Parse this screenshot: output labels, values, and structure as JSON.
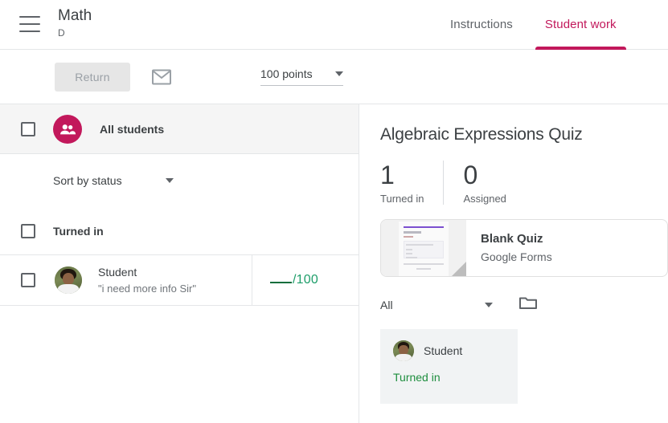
{
  "header": {
    "menu_icon": "hamburger-menu-icon",
    "course_title": "Math",
    "course_section": "D",
    "tabs": [
      {
        "label": "Instructions",
        "active": false
      },
      {
        "label": "Student work",
        "active": true
      }
    ]
  },
  "toolbar": {
    "return_label": "Return",
    "mail_icon": "envelope-icon",
    "points_value": "100 points"
  },
  "left_pane": {
    "all_students_label": "All students",
    "all_students_avatar_icon": "people-group-icon",
    "sort_label": "Sort by status",
    "section_label": "Turned in",
    "students": [
      {
        "name": "Student",
        "comment": "\"i need more info Sir\"",
        "grade_value": "",
        "grade_max": "/100"
      }
    ]
  },
  "right_pane": {
    "assignment_title": "Algebraic Expressions Quiz",
    "stats": [
      {
        "count": "1",
        "caption": "Turned in"
      },
      {
        "count": "0",
        "caption": "Assigned"
      }
    ],
    "attachment": {
      "name": "Blank Quiz",
      "type": "Google Forms",
      "thumbnail_icon": "google-form-thumbnail"
    },
    "filter_value": "All",
    "folder_icon": "folder-icon",
    "submissions": [
      {
        "name": "Student",
        "status": "Turned in"
      }
    ]
  },
  "colors": {
    "accent_magenta": "#c2185b",
    "status_green": "#1e8e3e",
    "grade_green": "#1e9e6a",
    "forms_purple": "#673ab7",
    "text_primary": "#3c4043",
    "text_secondary": "#5f6368"
  }
}
